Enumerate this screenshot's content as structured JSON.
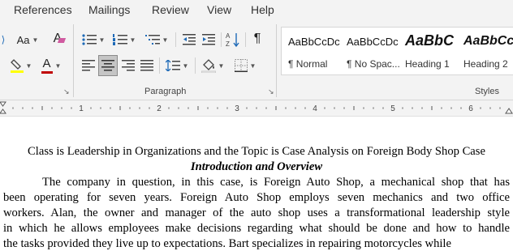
{
  "tabs": [
    "References",
    "Mailings",
    "Review",
    "View",
    "Help"
  ],
  "font_group": {
    "case_label": "Aa",
    "clear_format_label": "A",
    "font_color_label": "A"
  },
  "paragraph_group": {
    "label": "Paragraph",
    "pilcrow": "¶"
  },
  "styles_group": {
    "label": "Styles",
    "items": [
      {
        "sample": "AaBbCcDc",
        "name": "¶ Normal"
      },
      {
        "sample": "AaBbCcDc",
        "name": "¶ No Spac..."
      },
      {
        "sample": "AaBbC",
        "name": "Heading 1"
      },
      {
        "sample": "AaBbCc",
        "name": "Heading 2"
      }
    ]
  },
  "colors": {
    "highlight": "#ffff00",
    "font_color": "#c00000",
    "selected_button": "#c5c5c5"
  },
  "ruler": {
    "numbers": [
      "1",
      "2",
      "3",
      "4",
      "5",
      "6"
    ]
  },
  "document": {
    "title_line": "Class is Leadership in Organizations and the Topic is Case Analysis on Foreign Body Shop Case",
    "heading": "Introduction and Overview",
    "paragraph_lines": [
      "The company in question, in this case, is Foreign Auto Shop, a mechanical shop that has",
      "been operating for seven years. Foreign Auto Shop employs seven mechanics and two office",
      "workers. Alan, the owner and manager of the auto shop uses a transformational leadership style",
      "in which he allows employees make decisions regarding what should be done and how to handle",
      "the tasks provided they live up to expectations. Bart specializes in repairing motorcycles while"
    ]
  }
}
